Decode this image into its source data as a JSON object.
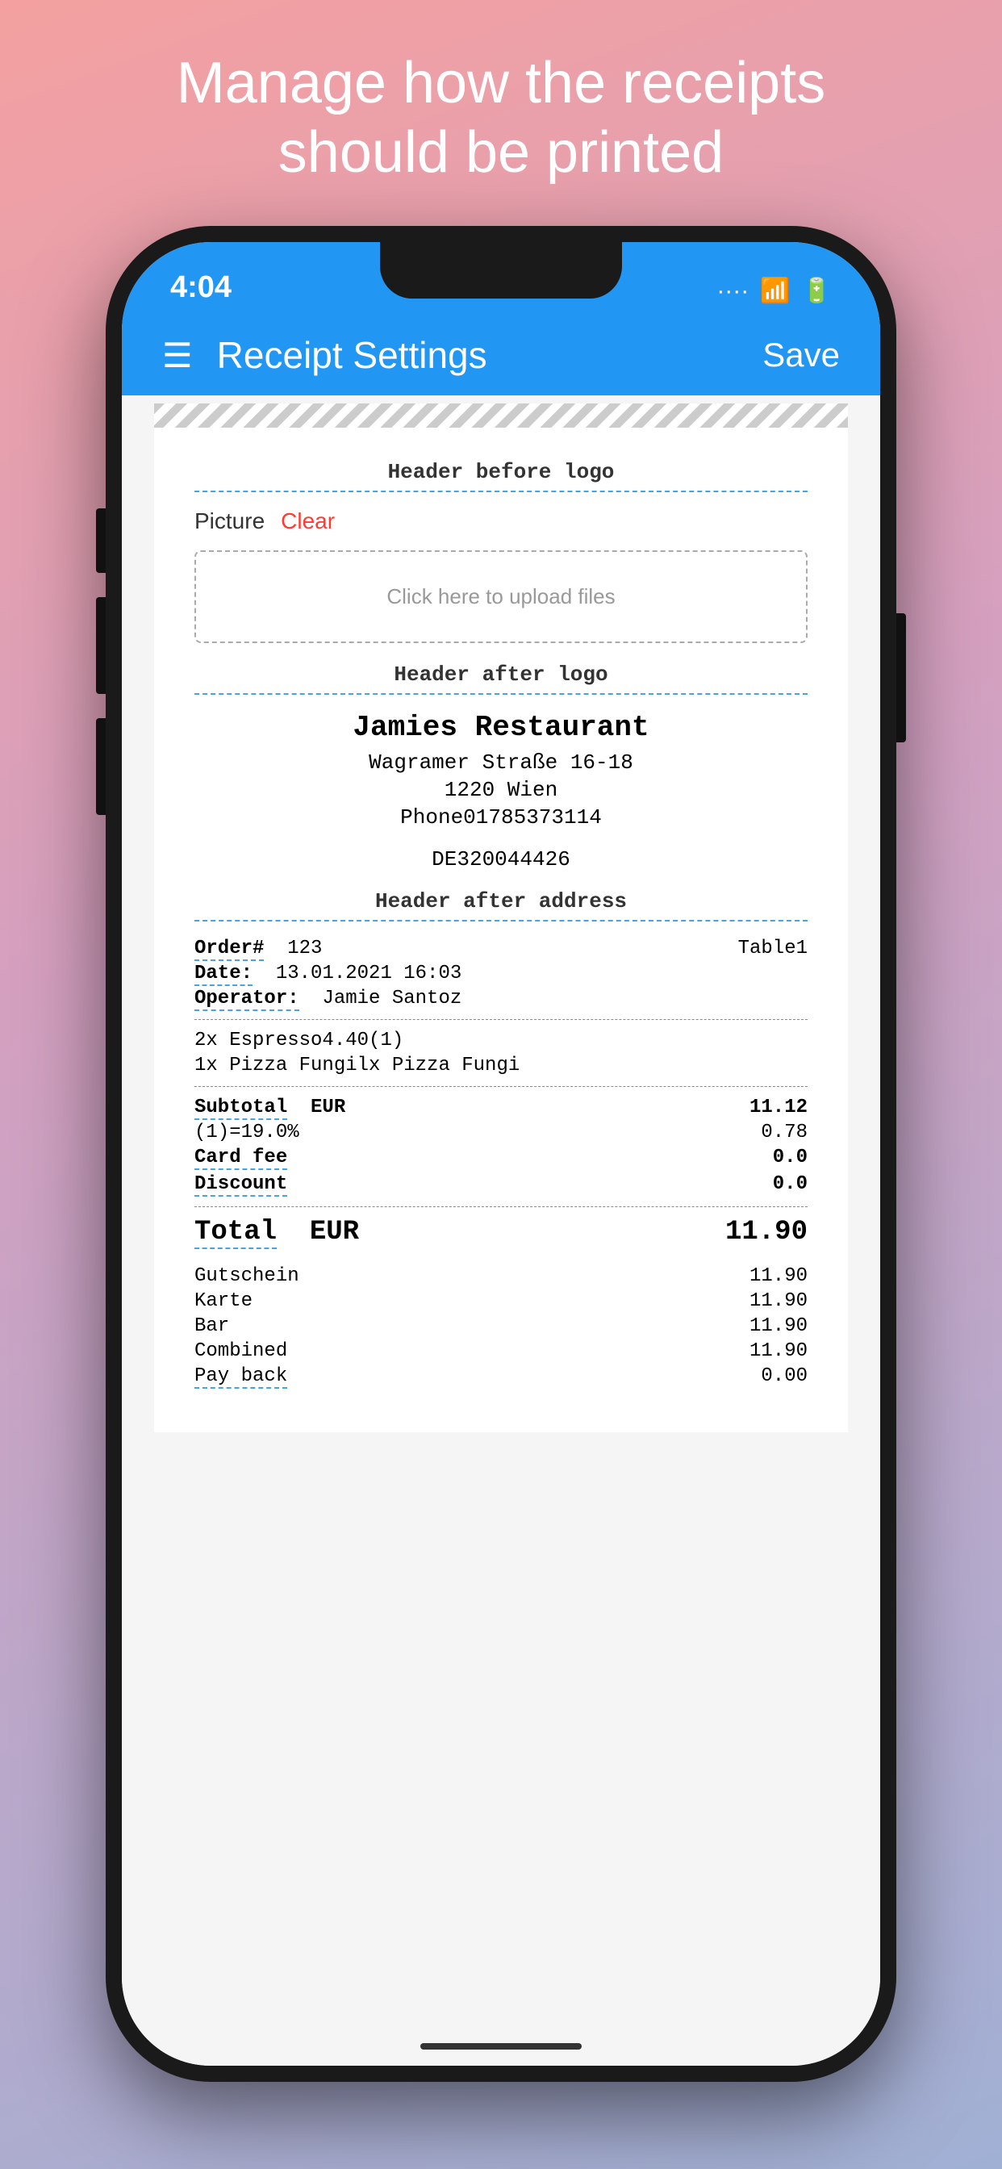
{
  "page": {
    "title_line1": "Manage how the receipts",
    "title_line2": "should be printed"
  },
  "status_bar": {
    "time": "4:04"
  },
  "app_bar": {
    "title": "Receipt Settings",
    "save_label": "Save"
  },
  "receipt": {
    "header_before_logo": "Header before logo",
    "picture_label": "Picture",
    "clear_label": "Clear",
    "upload_label": "Click here to upload files",
    "header_after_logo": "Header after logo",
    "restaurant_name": "Jamies Restaurant",
    "address_line1": "Wagramer Straße 16-18",
    "address_line2": "1220 Wien",
    "phone": "Phone01785373114",
    "vat": "DE320044426",
    "header_after_address": "Header after address",
    "order_number_label": "Order#",
    "order_number": "123",
    "table_label": "Table1",
    "date_label": "Date:",
    "date_value": "13.01.2021 16:03",
    "operator_label": "Operator:",
    "operator_value": "Jamie Santoz",
    "item1": "2x Espresso4.40(1)",
    "item2": "1x Pizza Fungilx Pizza Fungi",
    "subtotal_label": "Subtotal",
    "subtotal_currency": "EUR",
    "subtotal_value": "11.12",
    "tax_label": "(1)=19.0%",
    "tax_value": "0.78",
    "card_fee_label": "Card fee",
    "card_fee_value": "0.0",
    "discount_label": "Discount",
    "discount_value": "0.0",
    "total_label": "Total",
    "total_currency": "EUR",
    "total_value": "11.90",
    "gutschein_label": "Gutschein",
    "gutschein_value": "11.90",
    "karte_label": "Karte",
    "karte_value": "11.90",
    "bar_label": "Bar",
    "bar_value": "11.90",
    "combined_label": "Combined",
    "combined_value": "11.90",
    "payback_label": "Pay back",
    "payback_value": "0.00"
  }
}
